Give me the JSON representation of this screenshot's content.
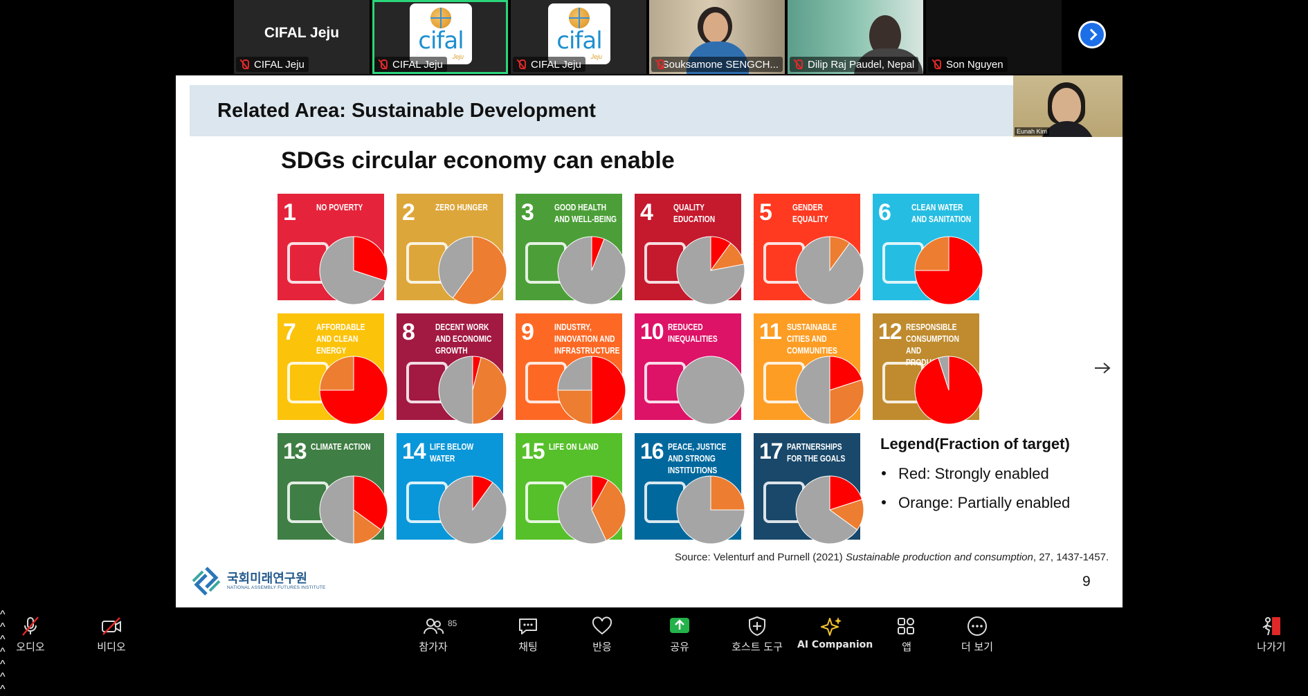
{
  "participants": [
    {
      "name": "CIFAL Jeju",
      "display": "CIFAL Jeju",
      "kind": "text",
      "active": false
    },
    {
      "name": "CIFAL Jeju",
      "display": "cifal",
      "kind": "logo",
      "active": true
    },
    {
      "name": "CIFAL Jeju",
      "display": "cifal",
      "kind": "logo",
      "active": false
    },
    {
      "name": "Souksamone SENGCH...",
      "kind": "video",
      "active": false
    },
    {
      "name": "Dilip Raj Paudel, Nepal",
      "kind": "video",
      "active": false
    },
    {
      "name": "Son Nguyen",
      "kind": "blank",
      "active": false
    }
  ],
  "logo_sub": "Jeju",
  "slide": {
    "header": "Related Area: Sustainable Development",
    "title": "SDGs circular economy can enable",
    "speaker_label": "Eunah Kim",
    "legend_title": "Legend(Fraction of target)",
    "legend_items": [
      "Red: Strongly enabled",
      "Orange: Partially enabled"
    ],
    "source_prefix": "Source: Velenturf and Purnell (2021) ",
    "source_journal": "Sustainable production and consumption",
    "source_suffix": ", 27, 1437-1457.",
    "page_number": "9",
    "logo_kor": "국회미래연구원",
    "logo_eng": "NATIONAL ASSEMBLY FUTURES INSTITUTE"
  },
  "pie_colors": {
    "red": "#ff0000",
    "orange": "#ed7d31",
    "grey": "#a5a5a5"
  },
  "sdgs": [
    {
      "num": "1",
      "label": "NO POVERTY",
      "color": "#e5243b",
      "red": 0.3,
      "orange": 0.0
    },
    {
      "num": "2",
      "label": "ZERO HUNGER",
      "color": "#dda63a",
      "red": 0.0,
      "orange": 0.6
    },
    {
      "num": "3",
      "label": "GOOD HEALTH AND WELL-BEING",
      "color": "#4c9f38",
      "red": 0.06,
      "orange": 0.0
    },
    {
      "num": "4",
      "label": "QUALITY EDUCATION",
      "color": "#c5192d",
      "red": 0.1,
      "orange": 0.12
    },
    {
      "num": "5",
      "label": "GENDER EQUALITY",
      "color": "#ff3a21",
      "red": 0.0,
      "orange": 0.1
    },
    {
      "num": "6",
      "label": "CLEAN WATER AND SANITATION",
      "color": "#26bde2",
      "red": 0.75,
      "orange": 0.25
    },
    {
      "num": "7",
      "label": "AFFORDABLE AND CLEAN ENERGY",
      "color": "#fcc30b",
      "red": 0.75,
      "orange": 0.25
    },
    {
      "num": "8",
      "label": "DECENT WORK AND ECONOMIC GROWTH",
      "color": "#a21942",
      "red": 0.04,
      "orange": 0.46
    },
    {
      "num": "9",
      "label": "INDUSTRY, INNOVATION AND INFRASTRUCTURE",
      "color": "#fd6925",
      "red": 0.5,
      "orange": 0.25
    },
    {
      "num": "10",
      "label": "REDUCED INEQUALITIES",
      "color": "#dd1367",
      "red": 0.0,
      "orange": 0.0
    },
    {
      "num": "11",
      "label": "SUSTAINABLE CITIES AND COMMUNITIES",
      "color": "#fd9d24",
      "red": 0.2,
      "orange": 0.3
    },
    {
      "num": "12",
      "label": "RESPONSIBLE CONSUMPTION AND PRODUCTION",
      "color": "#bf8b2e",
      "red": 0.95,
      "orange": 0.0
    },
    {
      "num": "13",
      "label": "CLIMATE ACTION",
      "color": "#3f7e44",
      "red": 0.35,
      "orange": 0.15
    },
    {
      "num": "14",
      "label": "LIFE BELOW WATER",
      "color": "#0a97d9",
      "red": 0.1,
      "orange": 0.0
    },
    {
      "num": "15",
      "label": "LIFE ON LAND",
      "color": "#56c02b",
      "red": 0.08,
      "orange": 0.35
    },
    {
      "num": "16",
      "label": "PEACE, JUSTICE AND STRONG INSTITUTIONS",
      "color": "#00689d",
      "red": 0.0,
      "orange": 0.25
    },
    {
      "num": "17",
      "label": "PARTNERSHIPS FOR THE GOALS",
      "color": "#19486a",
      "red": 0.2,
      "orange": 0.15
    }
  ],
  "toolbar": {
    "audio": "오디오",
    "video": "비디오",
    "participants": "참가자",
    "participant_count": "85",
    "chat": "채팅",
    "reactions": "반응",
    "share": "공유",
    "host_tools": "호스트 도구",
    "ai": "AI Companion",
    "apps": "앱",
    "more": "더 보기",
    "leave": "나가기"
  },
  "colors": {
    "accent_green": "#2bd67b",
    "share_green": "#24b24b",
    "zoom_blue": "#1d6fe8",
    "mute_red": "#e02828"
  }
}
